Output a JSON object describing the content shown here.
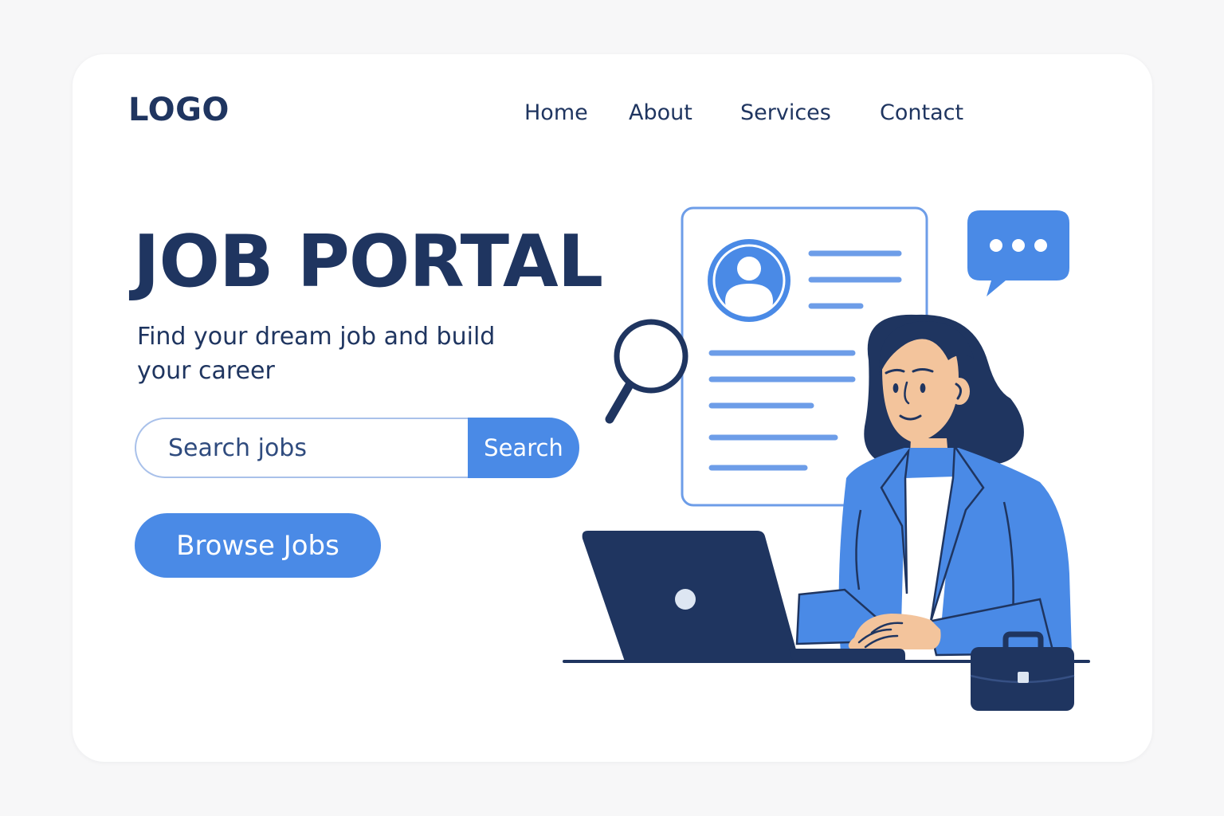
{
  "header": {
    "logo": "LOGO",
    "nav": {
      "home": "Home",
      "about": "About",
      "services": "Services",
      "contact": "Contact"
    }
  },
  "hero": {
    "title": "JOB PORTAL",
    "subtitle": "Find your dream job and build your career",
    "search": {
      "placeholder": "Search jobs",
      "value": "",
      "button_label": "Search"
    },
    "browse_label": "Browse Jobs"
  },
  "colors": {
    "primary": "#4a8ae6",
    "navy": "#1f3560",
    "light_blue": "#a9c1ea",
    "background": "#f7f7f8",
    "card": "#ffffff",
    "skin": "#f3c49c"
  },
  "icons": {
    "magnifier": "magnifier-icon",
    "chat": "chat-bubble-icon",
    "avatar": "user-avatar-icon",
    "briefcase": "briefcase-icon",
    "laptop": "laptop-icon"
  }
}
